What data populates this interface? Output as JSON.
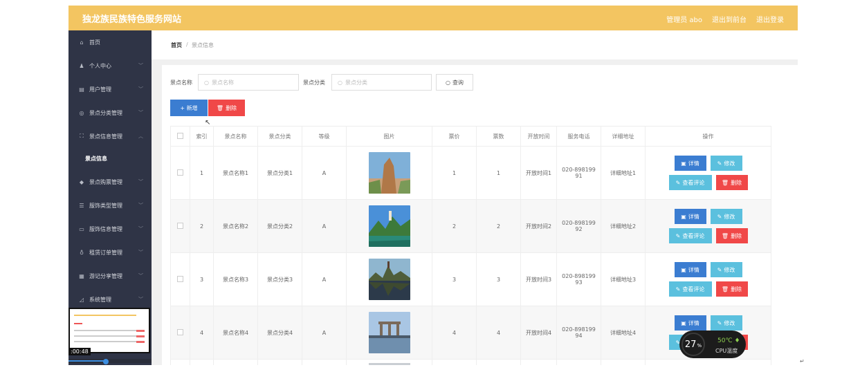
{
  "app": {
    "title": "独龙族民族特色服务网站",
    "top_links": [
      "管理员 abo",
      "退出到前台",
      "退出登录"
    ]
  },
  "sidebar": {
    "items": [
      {
        "label": "首页",
        "icon": "home-icon",
        "glyph": "⌂",
        "chevron": false
      },
      {
        "label": "个人中心",
        "icon": "user-icon",
        "glyph": "♟",
        "chevron": true
      },
      {
        "label": "用户管理",
        "icon": "users-icon",
        "glyph": "▤",
        "chevron": true
      },
      {
        "label": "景点分类管理",
        "icon": "globe-icon",
        "glyph": "◎",
        "chevron": true
      },
      {
        "label": "景点信息管理",
        "icon": "expand-icon",
        "glyph": "⛶",
        "chevron": true,
        "expanded": true
      },
      {
        "label": "景点购票管理",
        "icon": "pin-icon",
        "glyph": "◆",
        "chevron": true
      },
      {
        "label": "服饰类型管理",
        "icon": "list-icon",
        "glyph": "☰",
        "chevron": true
      },
      {
        "label": "服饰信息管理",
        "icon": "chat-icon",
        "glyph": "▭",
        "chevron": true
      },
      {
        "label": "租赁订单管理",
        "icon": "mic-icon",
        "glyph": "♁",
        "chevron": true
      },
      {
        "label": "游记分享管理",
        "icon": "grid-icon",
        "glyph": "▦",
        "chevron": true
      },
      {
        "label": "系统管理",
        "icon": "settings-icon",
        "glyph": "◿",
        "chevron": true
      }
    ],
    "sub_item": "景点信息"
  },
  "overlay": {
    "time": ":00:48",
    "video_progress": 0.45
  },
  "breadcrumb": {
    "home": "首页",
    "sep": "/",
    "current": "景点信息"
  },
  "search": {
    "name_label": "景点名称",
    "name_placeholder": "景点名称",
    "category_label": "景点分类",
    "category_placeholder": "景点分类",
    "query_button": "查询"
  },
  "actions": {
    "add": "+ 新增",
    "delete": "删除"
  },
  "table": {
    "headers": [
      "索引",
      "景点名称",
      "景点分类",
      "等级",
      "图片",
      "票价",
      "票数",
      "开放时间",
      "服务电话",
      "详细地址",
      "操作"
    ],
    "rows": [
      {
        "index": "1",
        "name": "景点名称1",
        "category": "景点分类1",
        "level": "A",
        "price": "1",
        "tickets": "1",
        "open_time": "开放时间1",
        "phone_a": "020-898199",
        "phone_b": "91",
        "address": "详细地址1"
      },
      {
        "index": "2",
        "name": "景点名称2",
        "category": "景点分类2",
        "level": "A",
        "price": "2",
        "tickets": "2",
        "open_time": "开放时间2",
        "phone_a": "020-898199",
        "phone_b": "92",
        "address": "详细地址2"
      },
      {
        "index": "3",
        "name": "景点名称3",
        "category": "景点分类3",
        "level": "A",
        "price": "3",
        "tickets": "3",
        "open_time": "开放时间3",
        "phone_a": "020-898199",
        "phone_b": "93",
        "address": "详细地址3"
      },
      {
        "index": "4",
        "name": "景点名称4",
        "category": "景点分类4",
        "level": "A",
        "price": "4",
        "tickets": "4",
        "open_time": "开放时间4",
        "phone_a": "020-898199",
        "phone_b": "94",
        "address": "详细地址4"
      }
    ],
    "op_labels": {
      "detail": "详情",
      "edit": "修改",
      "review": "查看评论",
      "delete": "删除"
    }
  },
  "cpu_widget": {
    "percent": "27",
    "percent_sign": "%",
    "temp": "50℃",
    "label": "CPU温度"
  },
  "colors": {
    "topbar": "#f3c561",
    "sidebar": "#2f3446",
    "primary": "#3b7dd1",
    "info": "#5bc0de",
    "danger": "#f04848"
  }
}
